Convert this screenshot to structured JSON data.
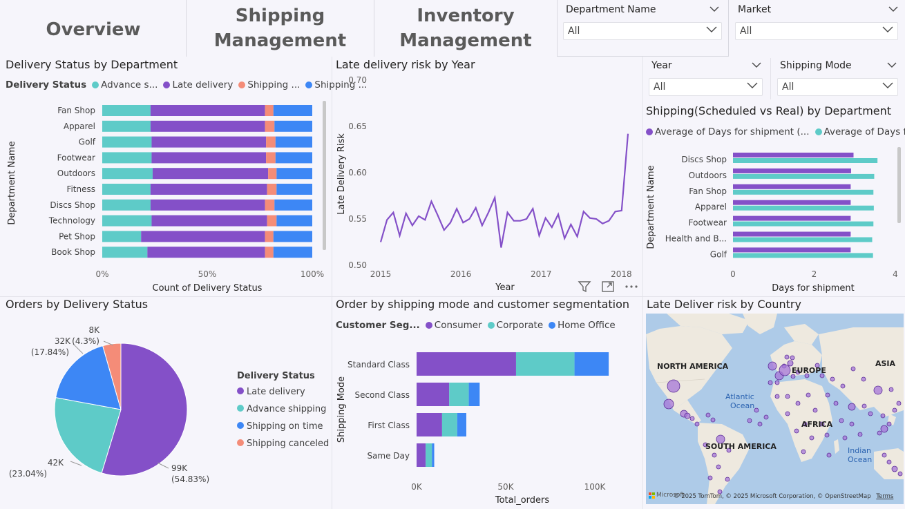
{
  "nav": {
    "overview": "Overview",
    "shipping_line1": "Shipping",
    "shipping_line2": "Management",
    "inventory_line1": "Inventory",
    "inventory_line2": "Management"
  },
  "slicers": {
    "department": {
      "label": "Department Name",
      "value": "All"
    },
    "market": {
      "label": "Market",
      "value": "All"
    },
    "year": {
      "label": "Year",
      "value": "All"
    },
    "shipping_mode": {
      "label": "Shipping Mode",
      "value": "All"
    }
  },
  "panels": {
    "delivery_status_dept": {
      "title": "Delivery Status by Department",
      "legend_title": "Delivery Status",
      "legend": [
        "Advance s...",
        "Late delivery",
        "Shipping ...",
        "Shipping ..."
      ]
    },
    "late_risk_year": {
      "title": "Late delivery risk by Year"
    },
    "sched_vs_real": {
      "title": "Shipping(Scheduled vs Real) by Department",
      "legend": [
        "Average of Days for shipment (...",
        "Average of Days for ..."
      ]
    },
    "orders_by_status": {
      "title": "Orders by Delivery Status",
      "legend_title": "Delivery Status",
      "legend": [
        "Late delivery",
        "Advance shipping",
        "Shipping on time",
        "Shipping canceled"
      ]
    },
    "ship_mode_segment": {
      "title": "Order by shipping mode and customer segmentation",
      "legend_title": "Customer Seg...",
      "legend": [
        "Consumer",
        "Corporate",
        "Home Office"
      ]
    },
    "map": {
      "title": "Late Deliver risk by Country",
      "labels": [
        "NORTH AMERICA",
        "EUROPE",
        "ASIA",
        "Atlantic",
        "Ocean",
        "AFRICA",
        "SOUTH AMERICA",
        "Indian",
        "Ocean"
      ],
      "attribution": "© 2025 TomTom, © 2025 Microsoft Corporation, © OpenStreetMap",
      "terms": "Terms",
      "brand": "Microsoft"
    }
  },
  "colors": {
    "teal": "#5ECBC8",
    "purple": "#8450C8",
    "salmon": "#F48C78",
    "blue": "#3D87F5"
  },
  "chart_data": [
    {
      "type": "bar",
      "orientation": "horizontal-stacked-100",
      "title": "Delivery Status by Department",
      "xlabel": "Count of Delivery Status",
      "ylabel": "Department Name",
      "categories": [
        "Fan Shop",
        "Apparel",
        "Golf",
        "Footwear",
        "Outdoors",
        "Fitness",
        "Discs Shop",
        "Technology",
        "Pet Shop",
        "Book Shop"
      ],
      "series": [
        {
          "name": "Advance s...",
          "values": [
            23,
            23,
            23.5,
            23.5,
            24,
            23,
            23,
            23.5,
            18.5,
            21.5
          ]
        },
        {
          "name": "Late delivery",
          "values": [
            54.5,
            54.5,
            54.5,
            54.5,
            55,
            55.5,
            54.5,
            55,
            59,
            56
          ]
        },
        {
          "name": "Shipping ...",
          "values": [
            4,
            4.5,
            4.5,
            4.5,
            4,
            4.5,
            4.5,
            4.5,
            4,
            4
          ]
        },
        {
          "name": "Shipping ...",
          "values": [
            18.5,
            18,
            17.5,
            17.5,
            17,
            17,
            18,
            17,
            18.5,
            18.5
          ]
        }
      ],
      "xticks": [
        "0%",
        "50%",
        "100%"
      ]
    },
    {
      "type": "line",
      "title": "Late delivery risk by Year",
      "xlabel": "Year",
      "ylabel": "Late Delivery Risk",
      "ylim": [
        0.5,
        0.7
      ],
      "yticks": [
        "0.50",
        "0.55",
        "0.60",
        "0.65",
        "0.70"
      ],
      "xticks": [
        "2015",
        "2016",
        "2017",
        "2018"
      ],
      "x": [
        2015.0,
        2015.083,
        2015.167,
        2015.25,
        2015.333,
        2015.417,
        2015.5,
        2015.583,
        2015.667,
        2015.75,
        2015.833,
        2015.917,
        2016.0,
        2016.083,
        2016.167,
        2016.25,
        2016.333,
        2016.417,
        2016.5,
        2016.583,
        2016.667,
        2016.75,
        2016.833,
        2016.917,
        2017.0,
        2017.083,
        2017.167,
        2017.25,
        2017.333,
        2017.417,
        2017.5,
        2017.583,
        2017.667,
        2017.75,
        2017.833,
        2017.917,
        2018.0,
        2018.083
      ],
      "values": [
        0.525,
        0.549,
        0.557,
        0.532,
        0.556,
        0.543,
        0.553,
        0.549,
        0.569,
        0.554,
        0.538,
        0.546,
        0.561,
        0.546,
        0.55,
        0.562,
        0.543,
        0.557,
        0.573,
        0.519,
        0.557,
        0.548,
        0.548,
        0.55,
        0.561,
        0.532,
        0.551,
        0.541,
        0.555,
        0.529,
        0.544,
        0.531,
        0.558,
        0.551,
        0.55,
        0.545,
        0.548,
        0.558,
        0.559,
        0.642
      ]
    },
    {
      "type": "bar",
      "orientation": "horizontal-clustered",
      "title": "Shipping(Scheduled vs Real) by Department",
      "xlabel": "Days for shipment",
      "ylabel": "Department Name",
      "categories": [
        "Discs Shop",
        "Outdoors",
        "Fan Shop",
        "Apparel",
        "Footwear",
        "Health and B...",
        "Golf"
      ],
      "series": [
        {
          "name": "Average of Days for shipment (...",
          "values": [
            2.97,
            2.91,
            2.9,
            2.9,
            2.9,
            2.9,
            2.9
          ]
        },
        {
          "name": "Average of Days for ...",
          "values": [
            3.56,
            3.48,
            3.46,
            3.47,
            3.46,
            3.43,
            3.45
          ]
        }
      ],
      "xlim": [
        0,
        4
      ],
      "xticks": [
        "0",
        "2",
        "4"
      ]
    },
    {
      "type": "pie",
      "title": "Orders by Delivery Status",
      "categories": [
        "Late delivery",
        "Advance shipping",
        "Shipping on time",
        "Shipping canceled"
      ],
      "values": [
        99,
        42,
        32,
        8
      ],
      "labels": [
        "99K",
        "42K",
        "32K",
        "8K"
      ],
      "percents": [
        "(54.83%)",
        "(23.04%)",
        "(17.84%)",
        "(4.3%)"
      ]
    },
    {
      "type": "bar",
      "orientation": "horizontal-stacked",
      "title": "Order by shipping mode and customer segmentation",
      "xlabel": "Total_orders",
      "ylabel": "Shipping Mode",
      "categories": [
        "Standard Class",
        "Second Class",
        "First Class",
        "Same Day"
      ],
      "series": [
        {
          "name": "Consumer",
          "values": [
            55800,
            18300,
            14300,
            5100
          ]
        },
        {
          "name": "Corporate",
          "values": [
            32800,
            11000,
            8500,
            3500
          ]
        },
        {
          "name": "Home Office",
          "values": [
            19200,
            6100,
            5100,
            1300
          ]
        }
      ],
      "xlim": [
        0,
        110000
      ],
      "xticks": [
        "0K",
        "50K",
        "100K"
      ]
    }
  ]
}
